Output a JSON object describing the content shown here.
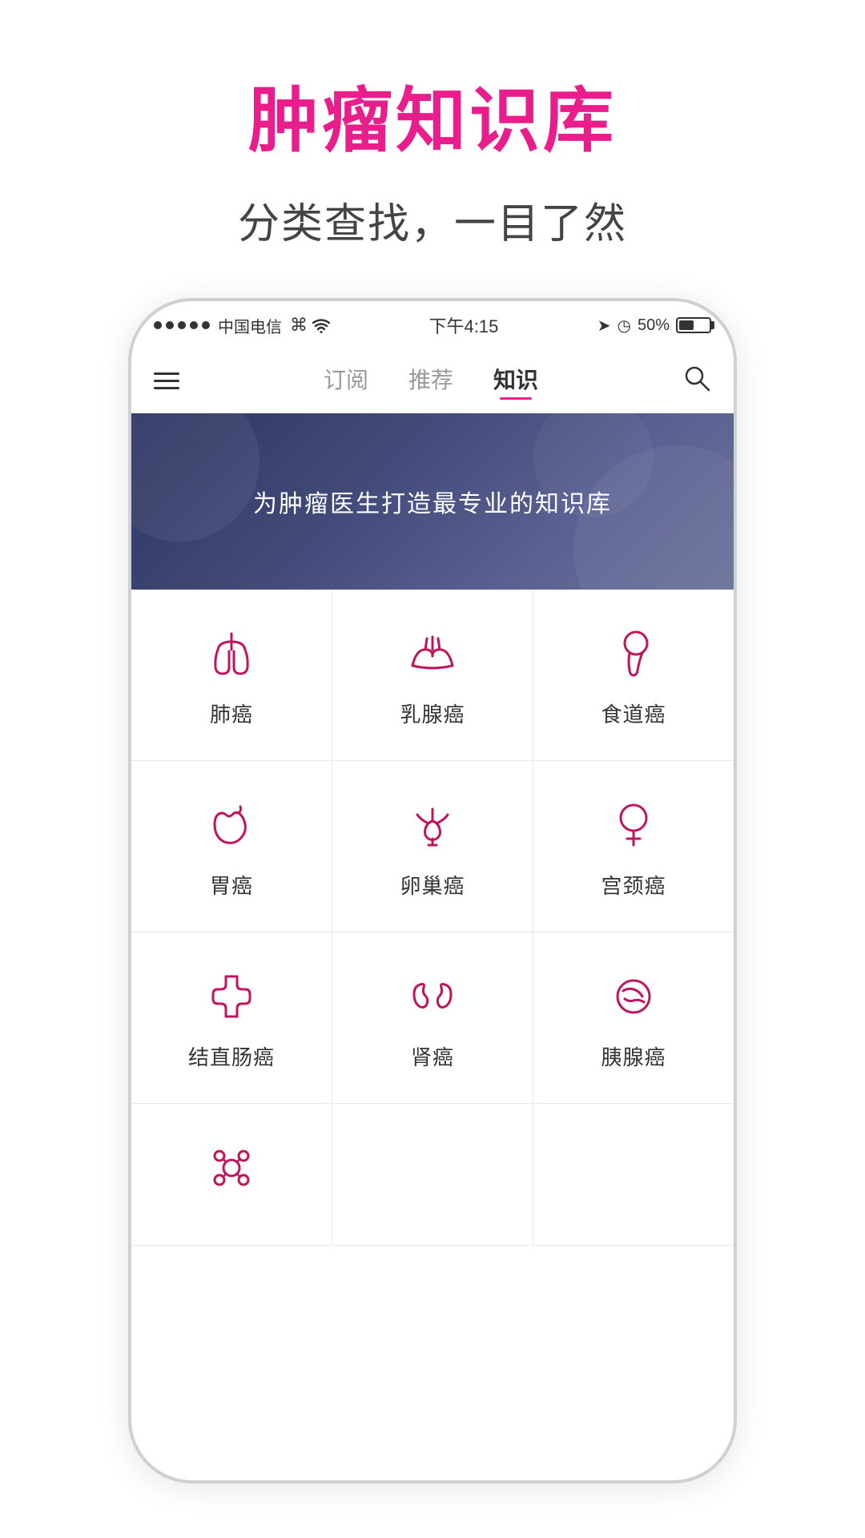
{
  "page": {
    "title": "肿瘤知识库",
    "subtitle": "分类查找，一目了然"
  },
  "status_bar": {
    "carrier": "中国电信",
    "wifi": "WiFi",
    "time": "下午4:15",
    "battery": "50%"
  },
  "nav": {
    "tab1": "订阅",
    "tab2": "推荐",
    "tab3": "知识",
    "active": "知识"
  },
  "banner": {
    "text": "为肿瘤医生打造最专业的知识库"
  },
  "grid": [
    [
      {
        "label": "肺癌",
        "icon": "lung"
      },
      {
        "label": "乳腺癌",
        "icon": "breast"
      },
      {
        "label": "食道癌",
        "icon": "esophagus"
      }
    ],
    [
      {
        "label": "胃癌",
        "icon": "stomach"
      },
      {
        "label": "卵巢癌",
        "icon": "ovary"
      },
      {
        "label": "宫颈癌",
        "icon": "cervix"
      }
    ],
    [
      {
        "label": "结直肠癌",
        "icon": "colon"
      },
      {
        "label": "肾癌",
        "icon": "kidney"
      },
      {
        "label": "胰腺癌",
        "icon": "pancreas"
      }
    ],
    [
      {
        "label": "",
        "icon": "lymph"
      },
      {
        "label": "",
        "icon": "empty"
      },
      {
        "label": "",
        "icon": "empty"
      }
    ]
  ]
}
